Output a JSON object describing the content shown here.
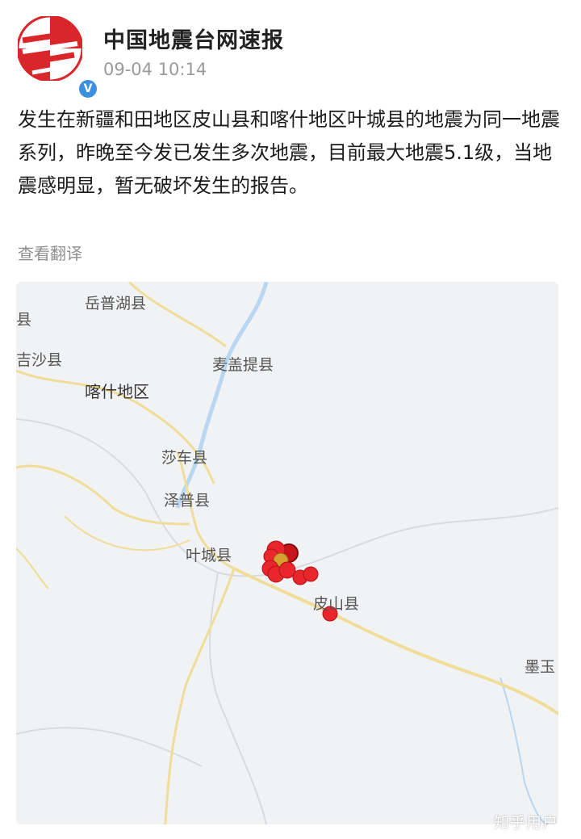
{
  "account": {
    "name": "中国地震台网速报",
    "time": "09-04 10:14",
    "verified_mark": "V"
  },
  "post": {
    "text": "发生在新疆和田地区皮山县和喀什地区叶城县的地震为同一地震系列，昨晚至今发已发生多次地震，目前最大地震5.1级，当地震感明显，暂无破坏发生的报告。",
    "translate_label": "查看翻译"
  },
  "map": {
    "labels": {
      "yuepuhu": "岳普湖县",
      "edge_county": "县",
      "jiashi": "吉沙县",
      "maigaiti": "麦盖提县",
      "kashgar": "喀什地区",
      "shache": "莎车县",
      "zepu": "泽普县",
      "yecheng": "叶城县",
      "pishan": "皮山县",
      "moyu": "墨玉"
    },
    "colors": {
      "background": "#f1f2f4",
      "road": "#f0dd9a",
      "river": "#b9d7f2",
      "boundary": "#d9dbe0",
      "quake": "#e8262c"
    }
  },
  "watermark": "知乎用户"
}
